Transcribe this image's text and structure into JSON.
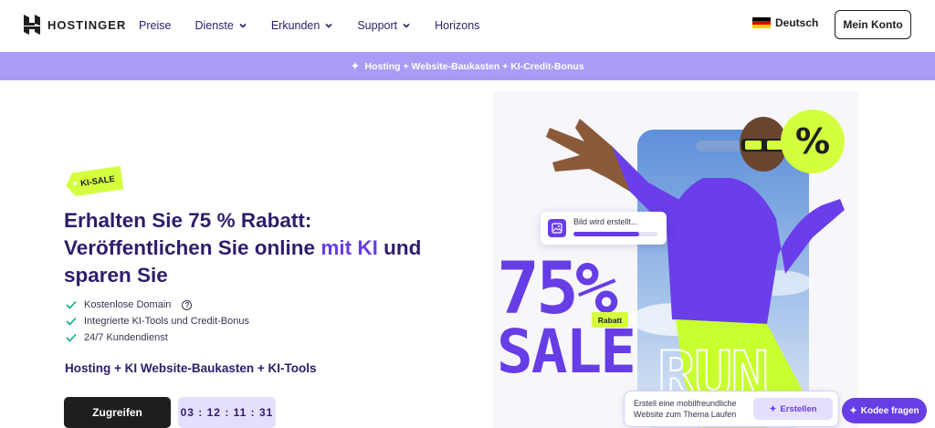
{
  "header": {
    "logo_text": "HOSTINGER",
    "nav": [
      {
        "label": "Preise",
        "has_dropdown": false
      },
      {
        "label": "Dienste",
        "has_dropdown": true
      },
      {
        "label": "Erkunden",
        "has_dropdown": true
      },
      {
        "label": "Support",
        "has_dropdown": true
      },
      {
        "label": "Horizons",
        "has_dropdown": false
      }
    ],
    "language": "Deutsch",
    "account_button": "Mein Konto"
  },
  "promo_bar": {
    "text": "Hosting + Website-Baukasten + KI-Credit-Bonus",
    "icon": "sparkle-icon"
  },
  "hero": {
    "badge": "KI-SALE",
    "title_part1": "Erhalten Sie 75 % Rabatt: Veröffentlichen Sie online ",
    "title_highlight": "mit KI",
    "title_part2": " und sparen Sie",
    "features": [
      {
        "label": "Kostenlose Domain",
        "help": true
      },
      {
        "label": "Integrierte KI-Tools und Credit-Bonus",
        "help": false
      },
      {
        "label": "24/7 Kundendienst",
        "help": false
      }
    ],
    "subheading": "Hosting + KI Website-Baukasten + KI-Tools",
    "cta_label": "Zugreifen",
    "timer": "03 : 12 : 11 : 31"
  },
  "art": {
    "percent_text": "75%",
    "sale_text": "SALE",
    "rabatt_label": "Rabatt",
    "run_text": "RUN",
    "percent_badge": "%",
    "generating_label": "Bild wird erstellt...",
    "generating_progress": 0.78
  },
  "prompt_widget": {
    "text": "Erstell eine mobilfreundliche Website zum Thema Laufen",
    "create_label": "Erstellen"
  },
  "chat_button": "Kodee fragen",
  "colors": {
    "primary": "#673de6",
    "dark": "#2f1c6a",
    "lime": "#d4ff3f",
    "promo": "#a99cf7"
  }
}
